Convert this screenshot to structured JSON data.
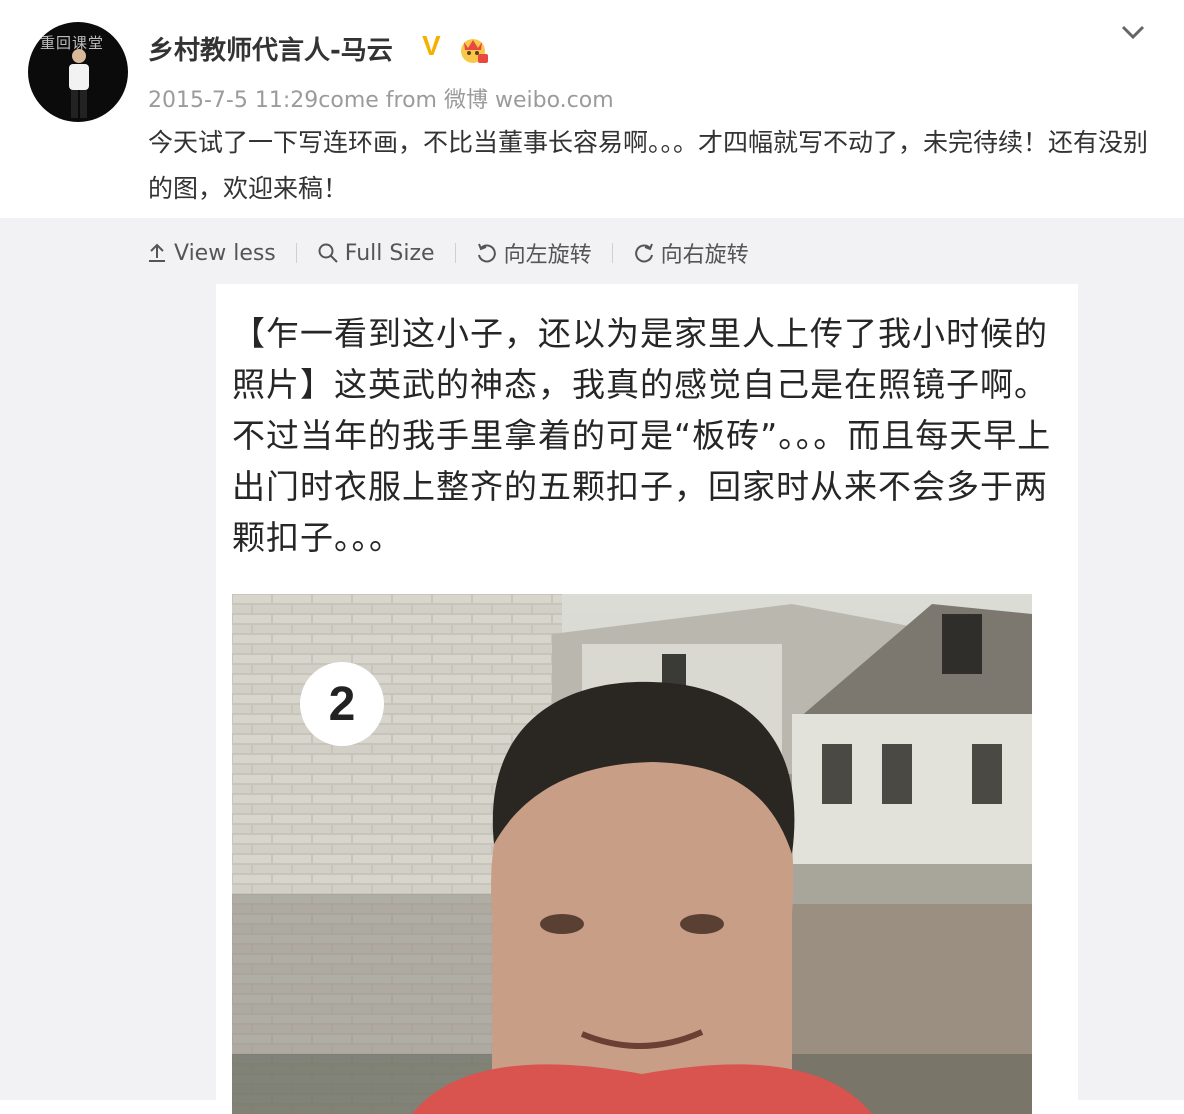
{
  "post": {
    "username": "乡村教师代言人-马云",
    "verified_badge": "V",
    "timestamp": "2015-7-5 11:29",
    "source_prefix": "come from",
    "source": "微博 weibo.com",
    "text": "今天试了一下写连环画，不比当董事长容易啊。。。才四幅就写不动了，未完待续！还有没别的图，欢迎来稿！",
    "avatar_text": "重回课堂"
  },
  "toolbar": {
    "view_less": "View less",
    "full_size": "Full Size",
    "rotate_left": "向左旋转",
    "rotate_right": "向右旋转"
  },
  "image": {
    "caption": "【乍一看到这小子，还以为是家里人上传了我小时候的照片】这英武的神态，我真的感觉自己是在照镜子啊。不过当年的我手里拿着的可是“板砖”。。。而且每天早上出门时衣服上整齐的五颗扣子，回家时从来不会多于两颗扣子。。。",
    "number": "2"
  },
  "icons": {
    "collapse": "chevron-down-icon",
    "view_less": "upload-arrow-icon",
    "full_size": "search-icon",
    "rotate_left": "rotate-left-icon",
    "rotate_right": "rotate-right-icon",
    "member": "member-crown-icon"
  },
  "colors": {
    "verified": "#f6b100",
    "media_bg": "#f2f2f5"
  }
}
